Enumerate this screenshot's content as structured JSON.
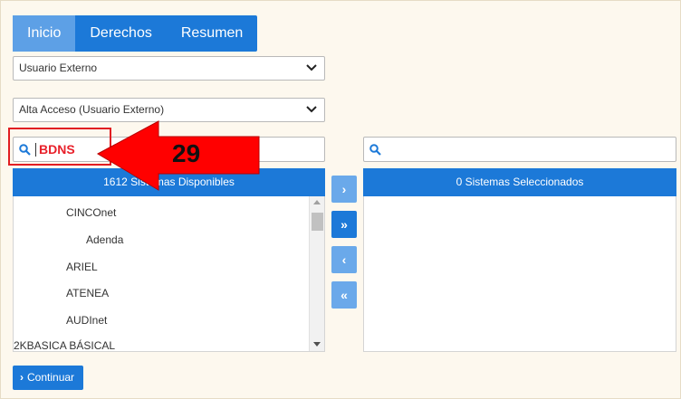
{
  "tabs": [
    {
      "label": "Inicio",
      "active": true
    },
    {
      "label": "Derechos",
      "active": false
    },
    {
      "label": "Resumen",
      "active": false
    }
  ],
  "selects": {
    "user_type": "Usuario Externo",
    "access_type": "Alta Acceso (Usuario Externo)"
  },
  "search_left": {
    "value": "BDNS",
    "icon": "search-icon"
  },
  "search_right": {
    "value": "",
    "icon": "search-icon"
  },
  "annotation": {
    "number": "29",
    "color": "#e11e22"
  },
  "available": {
    "header": "1612 Sistemas Disponibles",
    "items": [
      "CINCOnet",
      "Adenda",
      "ARIEL",
      "ATENEA",
      "AUDInet",
      "2KBASICA BÁSICAL"
    ]
  },
  "selected": {
    "header": "0 Sistemas Seleccionados"
  },
  "transfer_buttons": [
    {
      "label": "›",
      "icon": "chevron-right-icon"
    },
    {
      "label": "»",
      "icon": "double-chevron-right-icon"
    },
    {
      "label": "‹",
      "icon": "chevron-left-icon"
    },
    {
      "label": "«",
      "icon": "double-chevron-left-icon"
    }
  ],
  "continue_button": {
    "label": "Continuar",
    "icon": "chevron-right-icon"
  },
  "colors": {
    "primary": "#1c79d8",
    "active_tab": "#5da0e6",
    "background": "#fdf8ee",
    "highlight": "#e11e22"
  }
}
